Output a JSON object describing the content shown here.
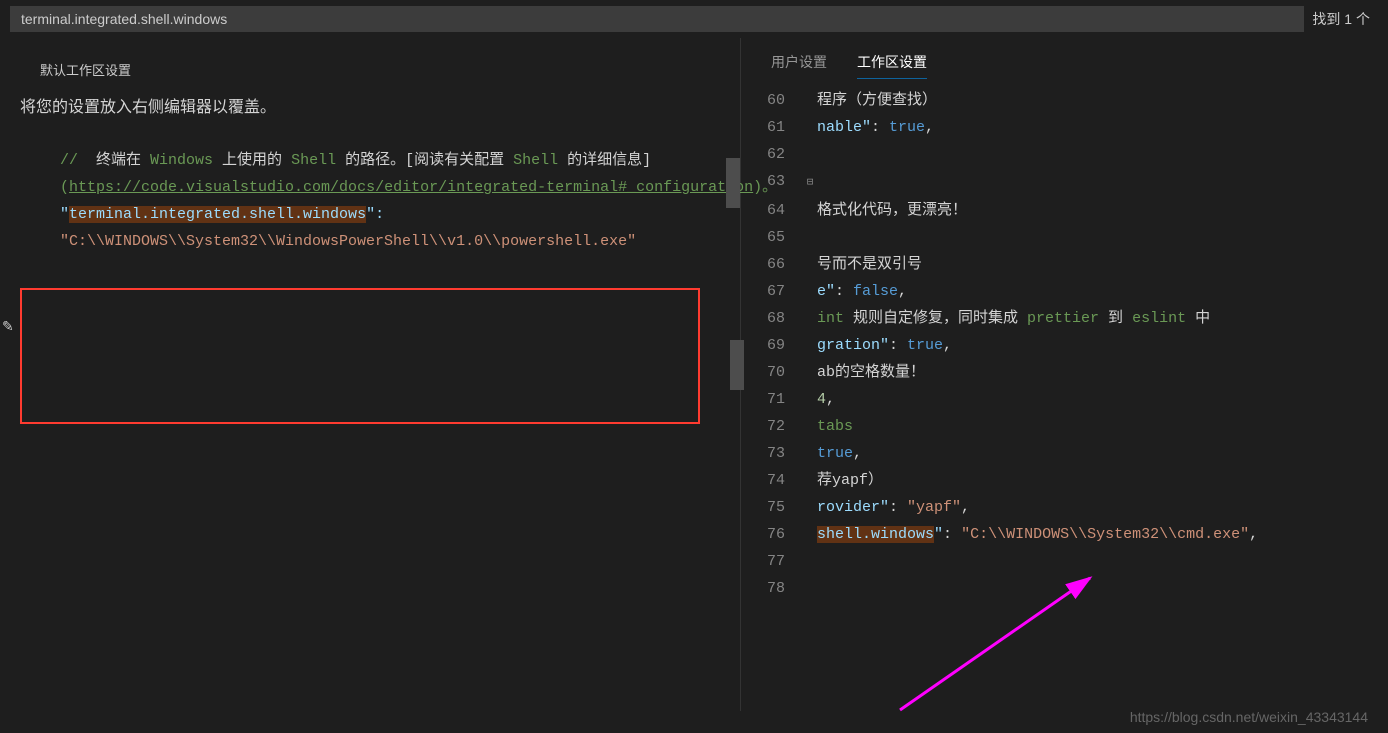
{
  "search": {
    "value": "terminal.integrated.shell.windows",
    "result_label": "找到 1 个"
  },
  "left": {
    "pane_title": "默认工作区设置",
    "instruction": "将您的设置放入右侧编辑器以覆盖。",
    "comment_prefix": "// ",
    "comment_word1": " 终端在 ",
    "comment_windows": "Windows",
    "comment_word2": " 上使用的 ",
    "comment_shell": "Shell",
    "comment_word3": " 的路径。[阅读有关配置 ",
    "comment_shell2": "Shell",
    "comment_word4": " 的详细信息]",
    "link_open": "(",
    "link_text": "https://code.visualstudio.com/docs/editor/integrated-terminal#_configuration",
    "link_close": ")。",
    "key_quote": "\"",
    "key_text": "terminal.integrated.shell.windows",
    "key_colon": "\":",
    "value_text": "\"C:\\\\WINDOWS\\\\System32\\\\WindowsPowerShell\\\\v1.0\\\\powershell.exe\"",
    "edit_icon": "✎"
  },
  "right": {
    "tab_user": "用户设置",
    "tab_workspace": "工作区设置",
    "lines": {
      "l60": "程序（方便查找）",
      "l61_key": "nable\"",
      "l61_colon": ": ",
      "l61_val": "true",
      "l61_comma": ",",
      "l63_blank": "",
      "l64": "格式化代码，更漂亮！",
      "l66": "号而不是双引号",
      "l67_key": "e\"",
      "l67_val": "false",
      "l68_pre": "int",
      "l68_cn1": " 规则自定修复，同时集成 ",
      "l68_mid": "prettier",
      "l68_cn2": " 到 ",
      "l68_end": "eslint",
      "l68_cn3": " 中",
      "l69_key": "gration\"",
      "l69_val": "true",
      "l70": "ab的空格数量！",
      "l71_val": "4",
      "l72": "tabs",
      "l73_val": "true",
      "l74": "荐yapf）",
      "l75_key": "rovider\"",
      "l75_val": "\"yapf\"",
      "l76_key": "shell.windows",
      "l76_keyq": "\"",
      "l76_val": "\"C:\\\\WINDOWS\\\\System32\\\\cmd.exe\""
    },
    "line_numbers": [
      "60",
      "61",
      "62",
      "63",
      "64",
      "65",
      "66",
      "67",
      "68",
      "69",
      "70",
      "71",
      "72",
      "73",
      "74",
      "75",
      "76",
      "77",
      "78"
    ]
  },
  "watermark": "https://blog.csdn.net/weixin_43343144"
}
